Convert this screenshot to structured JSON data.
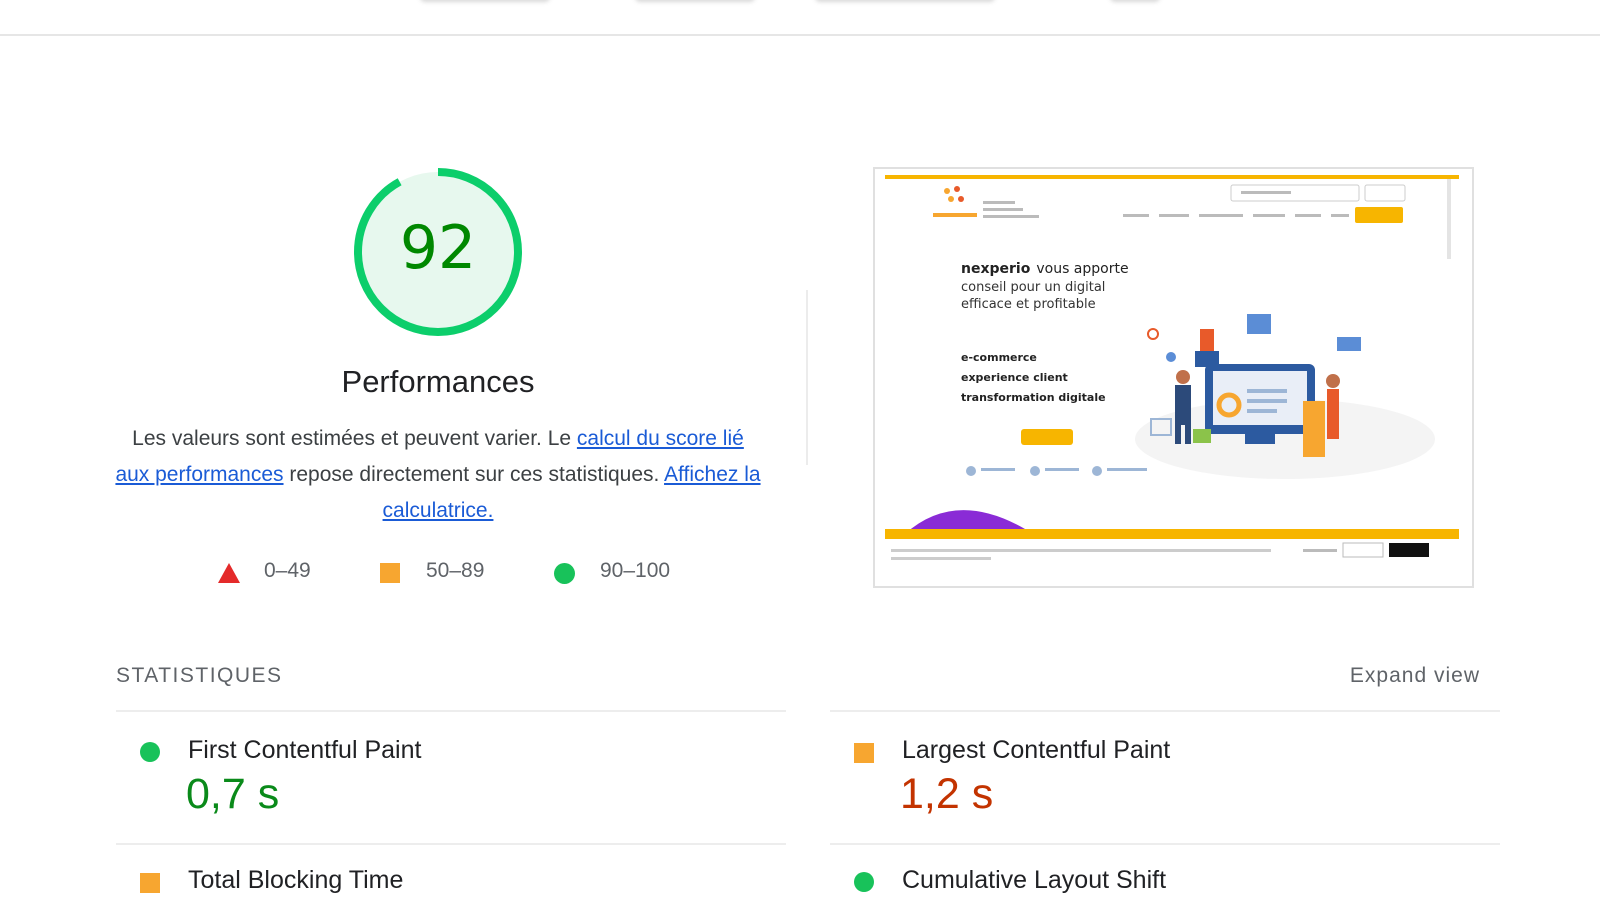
{
  "score": {
    "value": "92",
    "fraction": 0.92,
    "title": "Performances",
    "color": "#0cce6b"
  },
  "description": {
    "text1": "Les valeurs sont estimées et peuvent varier. Le ",
    "link1": "calcul du score lié aux performances",
    "text2": " repose directement sur ces statistiques. ",
    "link2": "Affichez la calculatrice."
  },
  "legend": [
    {
      "icon": "triangle-red-icon",
      "range": "0–49"
    },
    {
      "icon": "square-orange-icon",
      "range": "50–89"
    },
    {
      "icon": "circle-green-icon",
      "range": "90–100"
    }
  ],
  "screenshot": {
    "brand": "nexperio",
    "headline_rest": "vous apporte",
    "headline_line2": "conseil pour un digital",
    "headline_line3": "efficace et profitable",
    "service1": "e-commerce",
    "service2": "experience client",
    "service3": "transformation digitale"
  },
  "metrics": {
    "section_title": "STATISTIQUES",
    "expand_label": "Expand view",
    "items": [
      {
        "label": "First Contentful Paint",
        "value": "0,7 s",
        "status": "pass",
        "color": "#0a8a1a"
      },
      {
        "label": "Largest Contentful Paint",
        "value": "1,2 s",
        "status": "average",
        "color": "#c33300"
      },
      {
        "label": "Total Blocking Time",
        "value": "",
        "status": "average",
        "color": "#f7a630"
      },
      {
        "label": "Cumulative Layout Shift",
        "value": "",
        "status": "pass",
        "color": "#18c25a"
      }
    ]
  },
  "colors": {
    "pass": "#0cce6b",
    "average": "#ffa400",
    "fail": "#ff4e42",
    "link": "#1a5bd6"
  }
}
